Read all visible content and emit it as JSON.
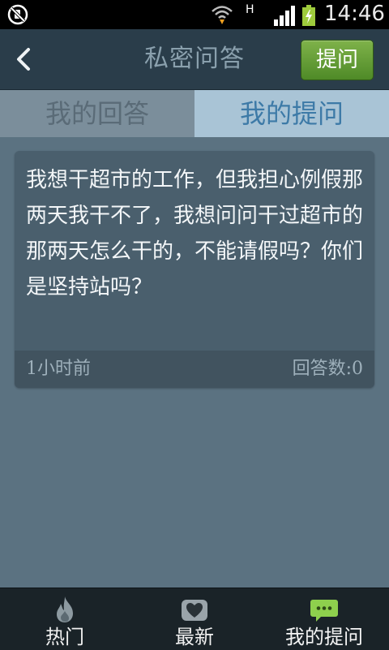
{
  "status_bar": {
    "network_type": "H",
    "time": "14:46"
  },
  "header": {
    "title": "私密问答",
    "ask_button": "提问"
  },
  "tabs": [
    {
      "label": "我的回答",
      "active": false
    },
    {
      "label": "我的提问",
      "active": true
    }
  ],
  "question_card": {
    "text": "我想干超市的工作，但我担心例假那两天我干不了，我想问问干过超市的那两天怎么干的，不能请假吗？你们是坚持站吗？",
    "time": "1小时前",
    "answers": "回答数:0"
  },
  "bottom_nav": [
    {
      "label": "热门",
      "icon": "flame-icon"
    },
    {
      "label": "最新",
      "icon": "heart-icon"
    },
    {
      "label": "我的提问",
      "icon": "chat-bubble-icon"
    }
  ],
  "colors": {
    "background": "#5b7281",
    "title_bar": "#2a3d4a",
    "ask_button": "#5f9a31",
    "tab_active": "#a9c4d6",
    "tab_inactive": "#7b8e9b",
    "card": "#4a5f6d",
    "bottom_nav": "#1a2328",
    "active_icon": "#8ed04d"
  }
}
